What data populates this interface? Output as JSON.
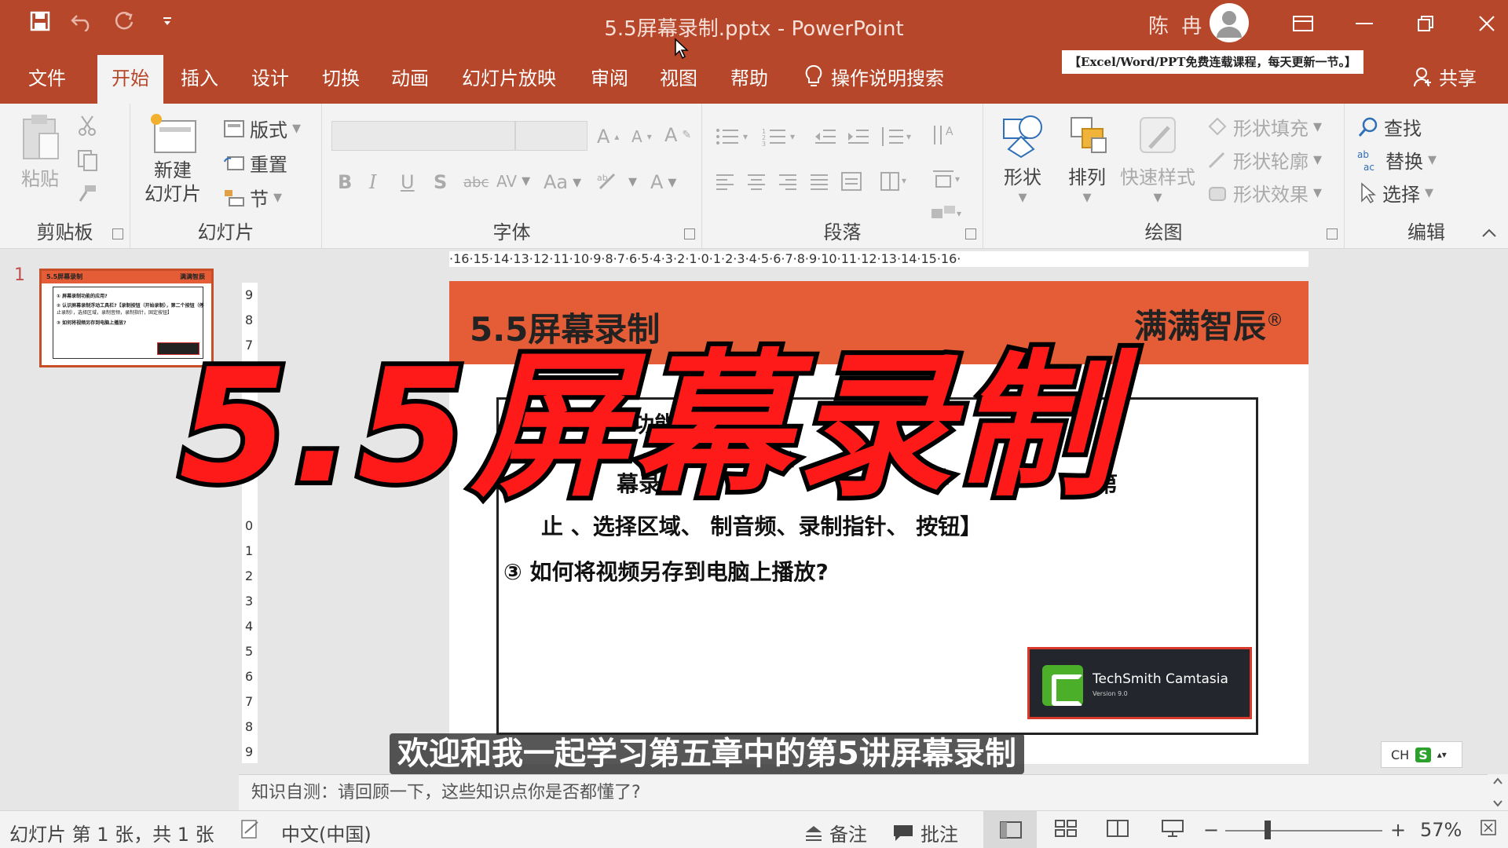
{
  "window": {
    "doc_title": "5.5屏幕录制.pptx  -  PowerPoint",
    "user_name": "陈 冉"
  },
  "tabs": [
    "文件",
    "开始",
    "插入",
    "设计",
    "切换",
    "动画",
    "幻灯片放映",
    "审阅",
    "视图",
    "帮助"
  ],
  "active_tab": "开始",
  "search_tip": "操作说明搜索",
  "promo_banner": "【Excel/Word/PPT免费连载课程，每天更新一节。】",
  "share_label": "共享",
  "ribbon": {
    "clipboard": {
      "label": "剪贴板",
      "paste": "粘贴"
    },
    "slides": {
      "label": "幻灯片",
      "new_slide_1": "新建",
      "new_slide_2": "幻灯片",
      "layout": "版式",
      "reset": "重置",
      "section": "节"
    },
    "font": {
      "label": "字体",
      "bold": "B",
      "italic": "I",
      "underline": "U",
      "shadow": "S",
      "strike": "abc",
      "spacing": "AV",
      "case": "Aa",
      "color": "A"
    },
    "paragraph": {
      "label": "段落"
    },
    "drawing": {
      "label": "绘图",
      "shapes": "形状",
      "arrange": "排列",
      "quick_styles": "快速样式",
      "fill": "形状填充",
      "outline": "形状轮廓",
      "effects": "形状效果"
    },
    "editing": {
      "label": "编辑",
      "find": "查找",
      "replace": "替换",
      "select": "选择"
    }
  },
  "thumbnail": {
    "number": "1",
    "title": "5.5屏幕录制",
    "brand": "满满智辰",
    "line1": "① 屏幕录制功能的应用?",
    "line2": "② 认识屏幕录制浮动工具栏?【录制按钮（开始录制），第二个按钮（停",
    "line3": "止录制），选择区域，录制音频，录制指针，固定按钮】",
    "line4": "③ 如何将视频另存到电脑上播放?"
  },
  "hruler_text": "·16·15·14·13·12·11·10·9·8·7·6·5·4·3·2·1·0·1·2·3·4·5·6·7·8·9·10·11·12·13·14·15·16·",
  "vruler": [
    "9",
    "8",
    "7",
    "0",
    "1",
    "2",
    "3",
    "4",
    "5",
    "6",
    "7",
    "8",
    "9"
  ],
  "slide": {
    "title": "5.5屏幕录制",
    "brand": "满满智辰",
    "registered": "®",
    "line1": "功能",
    "line2_left": "幕录",
    "line2_right": "第",
    "line3": "止       、选择区域、      制音频、录制指针、      按钮】",
    "line4": "③  如何将视频另存到电脑上播放?",
    "camtasia_text": "TechSmith Camtasia",
    "camtasia_version": "Version 9.0"
  },
  "overlay_title": "5.5屏幕录制",
  "subtitle": "欢迎和我一起学习第五章中的第5讲屏幕录制",
  "ime": {
    "lang": "CH",
    "symbol": "S"
  },
  "notes_text": "知识自测：请回顾一下，这些知识点你是否都懂了?",
  "status": {
    "slide_info": "幻灯片 第 1 张，共 1 张",
    "language": "中文(中国)",
    "notes": "备注",
    "comments": "批注",
    "zoom": "57%"
  },
  "colors": {
    "accent": "#b7472a",
    "slide_header": "#e55d36",
    "overlay_red": "#ff1a1a"
  }
}
